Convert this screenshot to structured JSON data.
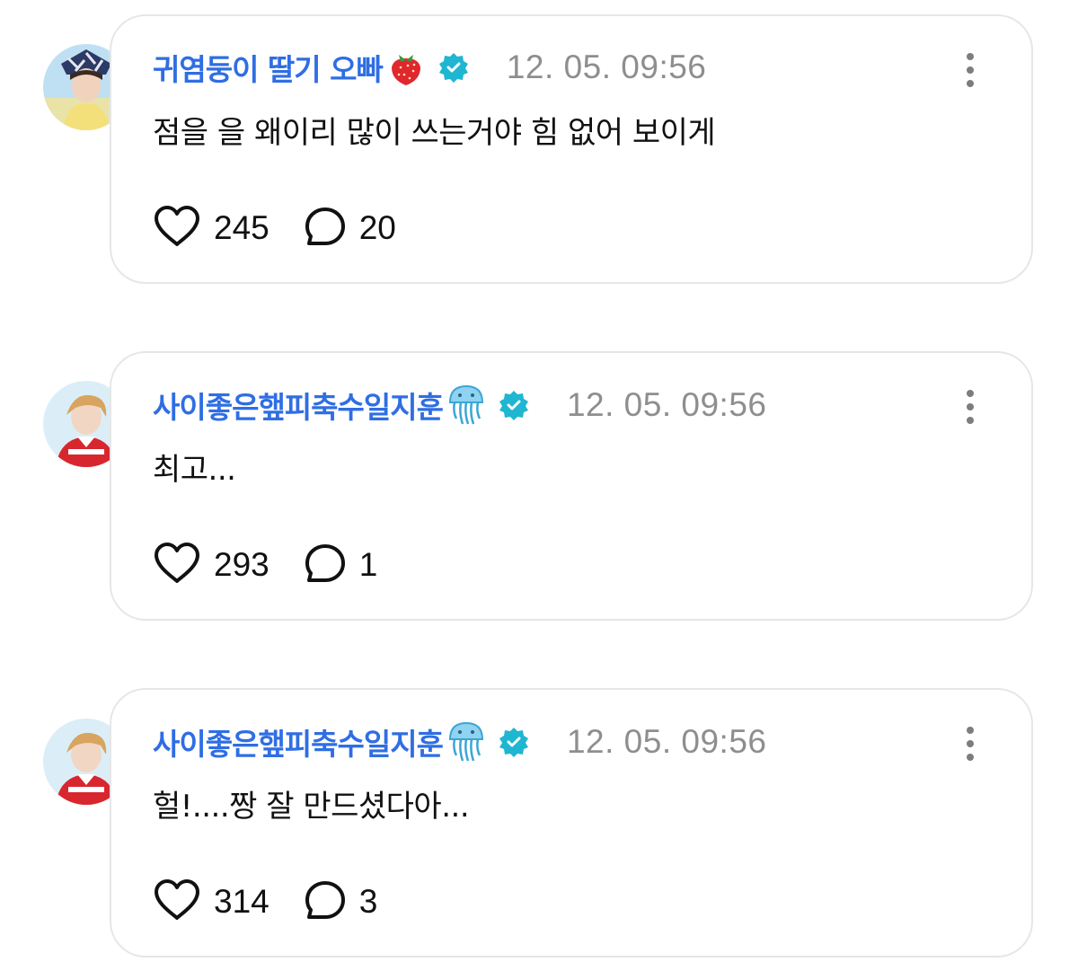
{
  "comments": [
    {
      "username": "귀염둥이 딸기 오빠",
      "badge_emoji": "strawberry-emoji",
      "verified_icon": "verified-badge-icon",
      "timestamp": "12. 05. 09:56",
      "text": "점을 을 왜이리 많이 쓰는거야 힘 없어 보이게",
      "likes": "245",
      "replies": "20"
    },
    {
      "username": "사이좋은햎피축수일지훈",
      "badge_emoji": "jellyfish-emoji",
      "verified_icon": "verified-badge-icon",
      "timestamp": "12. 05. 09:56",
      "text": "최고...",
      "likes": "293",
      "replies": "1"
    },
    {
      "username": "사이좋은햎피축수일지훈",
      "badge_emoji": "jellyfish-emoji",
      "verified_icon": "verified-badge-icon",
      "timestamp": "12. 05. 09:56",
      "text": "헐!....짱 잘 만드셨다아...",
      "likes": "314",
      "replies": "3"
    }
  ],
  "colors": {
    "username": "#2f6ee3",
    "verified": "#1fb6d1",
    "timestamp": "#8e8e8e",
    "card_border": "#e6e6e6"
  },
  "icons": {
    "like": "heart-icon",
    "reply": "speech-bubble-icon",
    "more": "more-vertical-icon"
  }
}
